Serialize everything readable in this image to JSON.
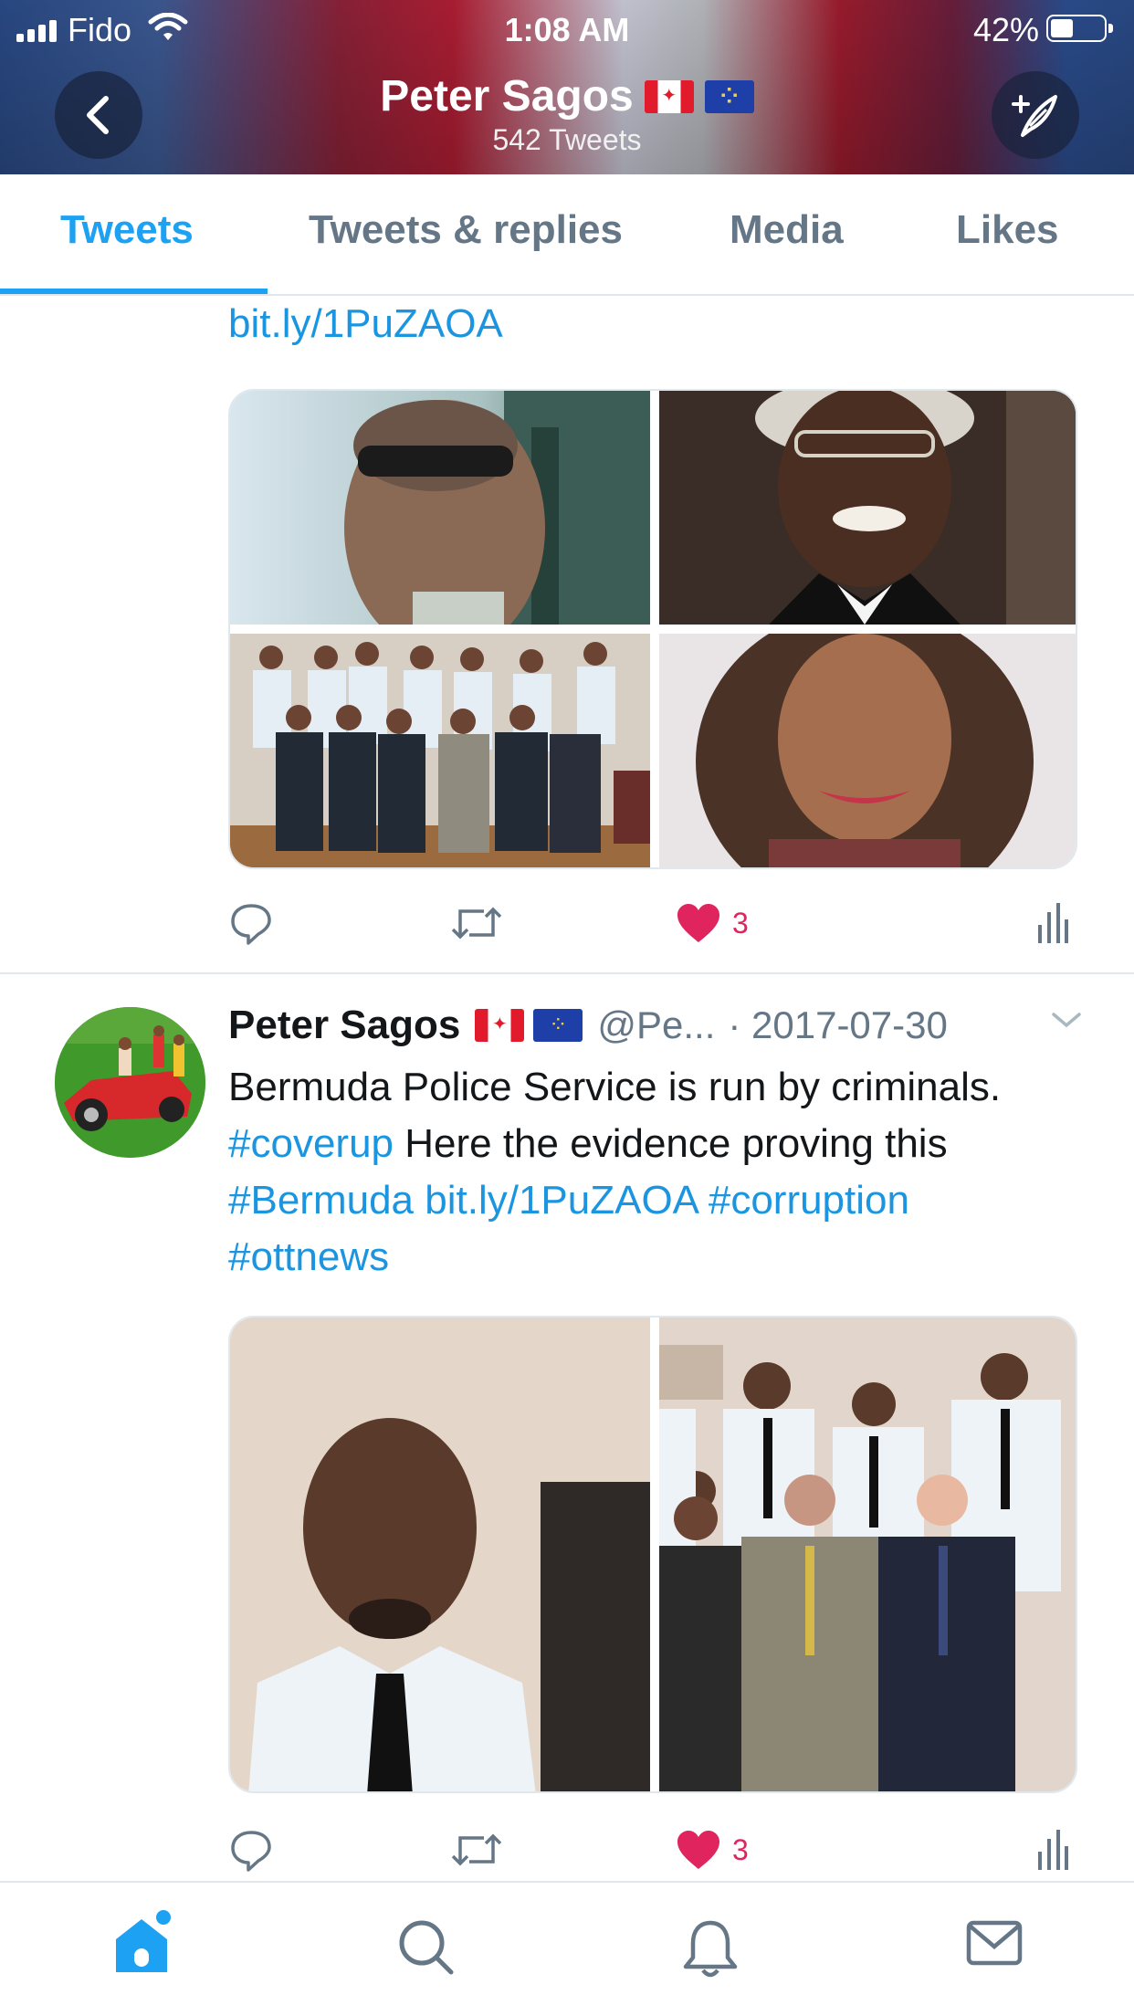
{
  "status_bar": {
    "carrier": "Fido",
    "time": "1:08 AM",
    "battery": "42%",
    "battery_level": 0.42
  },
  "header": {
    "title": "Peter Sagos",
    "subtitle": "542 Tweets",
    "title_flags": [
      "flag-canada",
      "flag-eu"
    ],
    "back_icon": "chevron-left-icon",
    "compose_icon": "compose-tweet-icon"
  },
  "tabs": [
    {
      "label": "Tweets",
      "active": true
    },
    {
      "label": "Tweets & replies",
      "active": false
    },
    {
      "label": "Media",
      "active": false
    },
    {
      "label": "Likes",
      "active": false
    }
  ],
  "tweets": [
    {
      "partial": true,
      "trailing_link": "bit.ly/1PuZAOA",
      "media": [
        "photo-man-sunglasses",
        "photo-judge-wig",
        "photo-police-group",
        "photo-woman-portrait"
      ],
      "actions": {
        "reply": "",
        "retweet": "",
        "likes": "3",
        "liked": true
      }
    },
    {
      "author": "Peter Sagos",
      "author_flags": [
        "flag-canada",
        "flag-eu"
      ],
      "handle": "@Pe...",
      "date": "· 2017-07-30",
      "text_segments": [
        {
          "text": "Bermuda Police Service is run by criminals. ",
          "link": false
        },
        {
          "text": "#coverup",
          "link": true
        },
        {
          "text": " Here the evidence proving this ",
          "link": false
        },
        {
          "text": "#Bermuda",
          "link": true
        },
        {
          "text": " ",
          "link": false
        },
        {
          "text": "bit.ly/1PuZAOA",
          "link": true
        },
        {
          "text": " ",
          "link": false
        },
        {
          "text": "#corruption",
          "link": true
        },
        {
          "text": " ",
          "link": false
        },
        {
          "text": "#ottnews",
          "link": true
        }
      ],
      "media": [
        "photo-officer-portrait",
        "photo-police-group-closeup"
      ],
      "actions": {
        "reply": "",
        "retweet": "",
        "likes": "3",
        "liked": true
      }
    }
  ],
  "bottom_tabs": [
    {
      "name": "home-icon",
      "active": true,
      "notification_dot": true
    },
    {
      "name": "search-icon",
      "active": false
    },
    {
      "name": "notifications-bell-icon",
      "active": false
    },
    {
      "name": "messages-envelope-icon",
      "active": false
    }
  ],
  "colors": {
    "accent": "#1da1f2",
    "link": "#1b95e0",
    "like": "#e0245e",
    "secondary_text": "#657786",
    "divider": "#e1e8ed"
  }
}
